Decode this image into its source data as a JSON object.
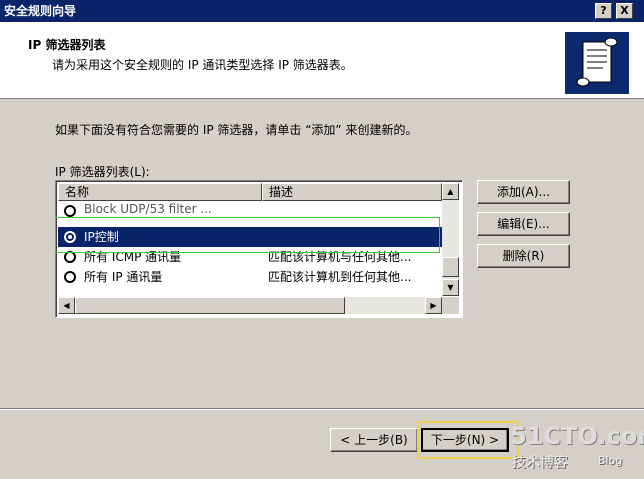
{
  "window": {
    "title": "安全规则向导",
    "help_label": "?",
    "close_label": "X"
  },
  "header": {
    "title": "IP 筛选器列表",
    "subtitle": "请为采用这个安全规则的 IP 通讯类型选择 IP 筛选器表。",
    "icon": "scroll-icon"
  },
  "main": {
    "intro": "如果下面没有符合您需要的 IP 筛选器，请单击 “添加” 来创建新的。",
    "list_label": "IP 筛选器列表(L):",
    "columns": [
      "名称",
      "描述"
    ],
    "rows": [
      {
        "name": "Block UDP/53 filter ...",
        "desc": "",
        "selected": false
      },
      {
        "name": "IP控制",
        "desc": "",
        "selected": true
      },
      {
        "name": "所有 ICMP 通讯量",
        "desc": "匹配该计算机与任何其他...",
        "selected": false
      },
      {
        "name": "所有 IP 通讯量",
        "desc": "匹配该计算机到任何其他...",
        "selected": false
      }
    ],
    "buttons": {
      "add": "添加(A)...",
      "edit": "编辑(E)...",
      "remove": "删除(R)"
    }
  },
  "footer": {
    "back": "< 上一步(B)",
    "next": "下一步(N) >"
  },
  "watermark": {
    "main": "51CTO.com",
    "sub": "技术博客",
    "blog": "Blog"
  },
  "colors": {
    "title_bar": "#0a246a",
    "selection": "#0a246a",
    "dialog_face": "#d4d0c8",
    "highlight_green": "#33cc33"
  }
}
